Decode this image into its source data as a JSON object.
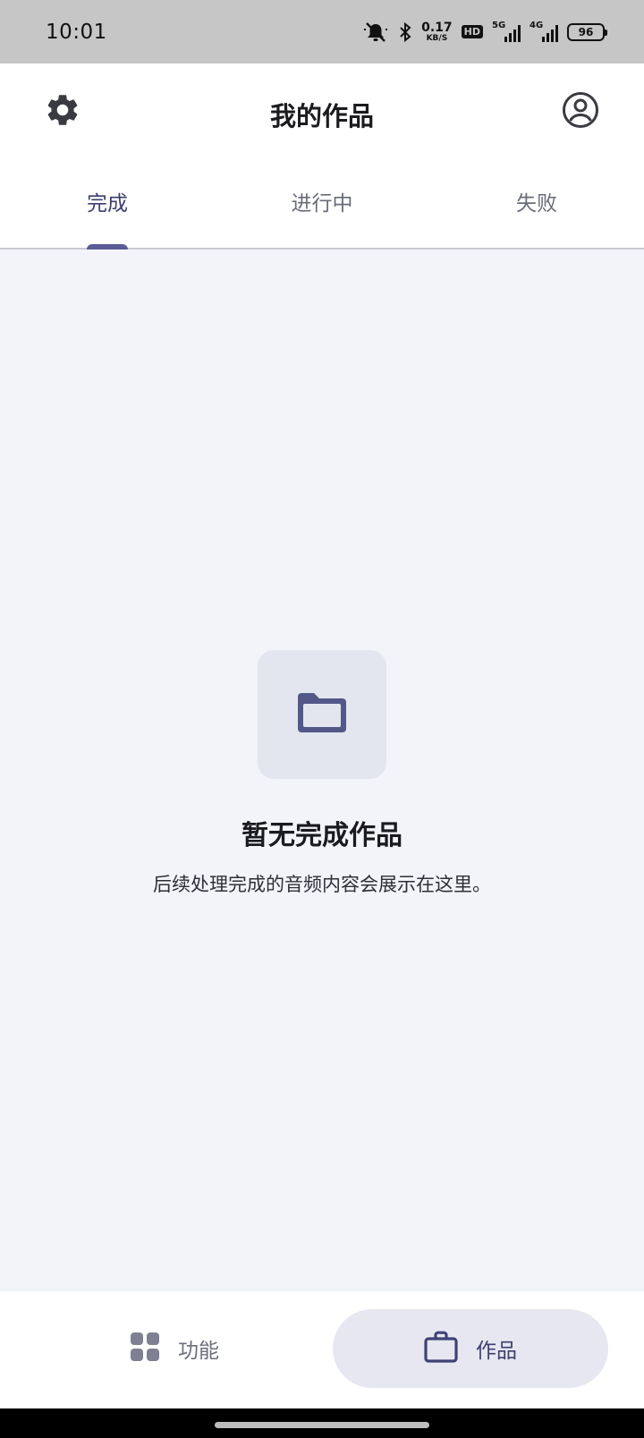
{
  "status_bar": {
    "time": "10:01",
    "net_speed_value": "0.17",
    "net_speed_unit": "KB/S",
    "hd_badge": "HD",
    "signal_1_tag": "5G",
    "signal_2_tag": "4G",
    "battery_level": "96",
    "icons": [
      "mute-icon",
      "bluetooth-icon",
      "signal-icon",
      "battery-icon"
    ]
  },
  "header": {
    "title": "我的作品",
    "settings_icon": "gear-icon",
    "profile_icon": "account-circle-icon"
  },
  "tabs": [
    {
      "label": "完成",
      "active": true
    },
    {
      "label": "进行中",
      "active": false
    },
    {
      "label": "失败",
      "active": false
    }
  ],
  "empty_state": {
    "icon": "folder-icon",
    "title": "暂无完成作品",
    "description": "后续处理完成的音频内容会展示在这里。"
  },
  "bottom_nav": {
    "items": [
      {
        "label": "功能",
        "icon": "grid-icon",
        "active": false
      },
      {
        "label": "作品",
        "icon": "briefcase-icon",
        "active": true
      }
    ]
  },
  "colors": {
    "accent": "#5a5c95",
    "accent_text": "#3c3f6e",
    "background": "#f3f4f9",
    "surface": "#ffffff",
    "status_bar_bg": "#c6c6c6"
  }
}
